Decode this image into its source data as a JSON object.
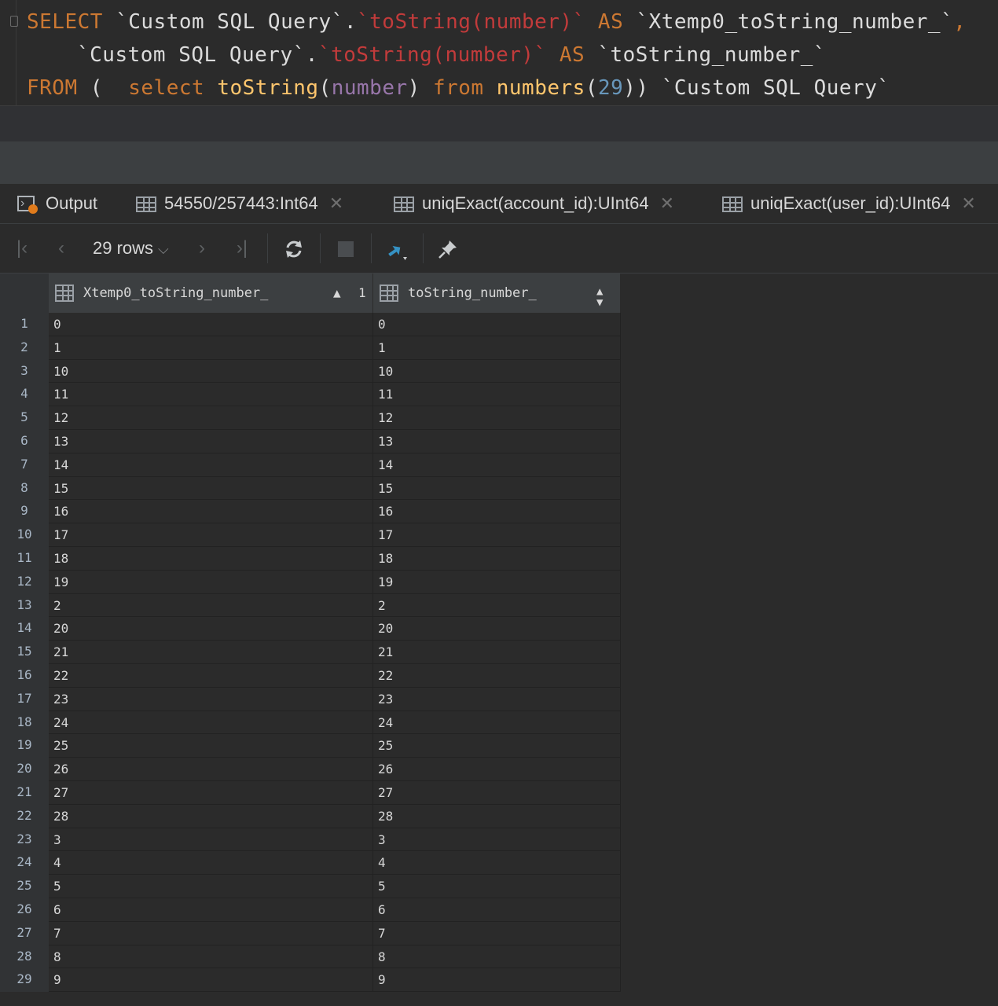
{
  "editor": {
    "line1": {
      "select": "SELECT",
      "part_a": " `Custom SQL Query`.",
      "part_b": "`toString(number)`",
      "part_c": " AS ",
      "part_d": "`Xtemp0_toString_number_`",
      "part_e": ","
    },
    "line2": {
      "part_a": "`Custom SQL Query`.",
      "part_b": "`toString(number)`",
      "part_c": " AS ",
      "part_d": "`toString_number_`"
    },
    "line3": {
      "from": "FROM",
      "paren": " (  ",
      "select": "select",
      "sp1": " ",
      "fn1": "toString",
      "p1": "(",
      "param": "number",
      "p2": ") ",
      "from2": "from",
      "sp2": " ",
      "fn2": "numbers",
      "p3": "(",
      "num": "29",
      "p4": ")) ",
      "alias": "`Custom SQL Query`"
    }
  },
  "tabs": [
    {
      "label": "Output",
      "icon": "output-icon"
    },
    {
      "label": "54550/257443:Int64",
      "icon": "table-icon"
    },
    {
      "label": "uniqExact(account_id):UInt64",
      "icon": "table-icon"
    },
    {
      "label": "uniqExact(user_id):UInt64",
      "icon": "table-icon"
    }
  ],
  "toolbar": {
    "rows_label": "29 rows"
  },
  "table": {
    "columns": [
      {
        "name": "Xtemp0_toString_number_",
        "sort": "ascending",
        "sort_index": "1"
      },
      {
        "name": "toString_number_",
        "sort": "none"
      }
    ],
    "rows": [
      [
        "0",
        "0"
      ],
      [
        "1",
        "1"
      ],
      [
        "10",
        "10"
      ],
      [
        "11",
        "11"
      ],
      [
        "12",
        "12"
      ],
      [
        "13",
        "13"
      ],
      [
        "14",
        "14"
      ],
      [
        "15",
        "15"
      ],
      [
        "16",
        "16"
      ],
      [
        "17",
        "17"
      ],
      [
        "18",
        "18"
      ],
      [
        "19",
        "19"
      ],
      [
        "2",
        "2"
      ],
      [
        "20",
        "20"
      ],
      [
        "21",
        "21"
      ],
      [
        "22",
        "22"
      ],
      [
        "23",
        "23"
      ],
      [
        "24",
        "24"
      ],
      [
        "25",
        "25"
      ],
      [
        "26",
        "26"
      ],
      [
        "27",
        "27"
      ],
      [
        "28",
        "28"
      ],
      [
        "3",
        "3"
      ],
      [
        "4",
        "4"
      ],
      [
        "5",
        "5"
      ],
      [
        "6",
        "6"
      ],
      [
        "7",
        "7"
      ],
      [
        "8",
        "8"
      ],
      [
        "9",
        "9"
      ]
    ]
  },
  "colors": {
    "background": "#2b2b2b",
    "keyword": "#cc7832",
    "function": "#ffc66d",
    "quoted_name": "#c23b3b",
    "number": "#6897bb",
    "parameter": "#9876aa",
    "accent_blue": "#3592c4"
  }
}
